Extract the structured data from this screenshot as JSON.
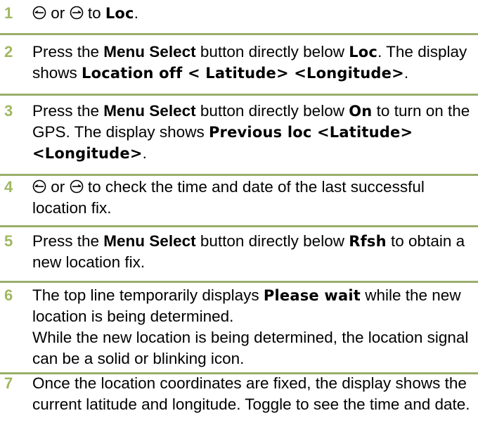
{
  "colors": {
    "step_number": "#a0b860",
    "rule": "#9aae6a"
  },
  "icons": [
    "scroll-left-icon",
    "scroll-right-icon"
  ],
  "steps": [
    {
      "number": "1",
      "or": "or",
      "to": "to",
      "loc": "Loc",
      "end": "."
    },
    {
      "number": "2",
      "t1": "Press the ",
      "menu": "Menu Select",
      "t2": " button directly below ",
      "d1": "Loc",
      "t3": ". The display shows ",
      "d2": "Location off < Latitude> <Longitude>",
      "t4": "."
    },
    {
      "number": "3",
      "t1": "Press the ",
      "menu": "Menu Select",
      "t2": " button directly below ",
      "d1": "On",
      "t3": " to turn on the GPS. The display shows ",
      "d2": "Previous loc <Latitude> <Longitude>",
      "t4": "."
    },
    {
      "number": "4",
      "or": "or",
      "text": "to check the time and date of the last successful location fix."
    },
    {
      "number": "5",
      "t1": "Press the ",
      "menu": "Menu Select",
      "t2": " button directly below ",
      "d1": "Rfsh",
      "t3": " to obtain a new location fix."
    },
    {
      "number": "6",
      "t1": "The top line temporarily displays ",
      "d1": "Please wait",
      "t2": " while the new location is being determined.",
      "p2": "While the new location is being determined, the location signal can be a solid or blinking icon."
    },
    {
      "number": "7",
      "text": "Once the location coordinates are fixed, the display shows the current latitude and longitude. Toggle to see the time and date."
    }
  ]
}
